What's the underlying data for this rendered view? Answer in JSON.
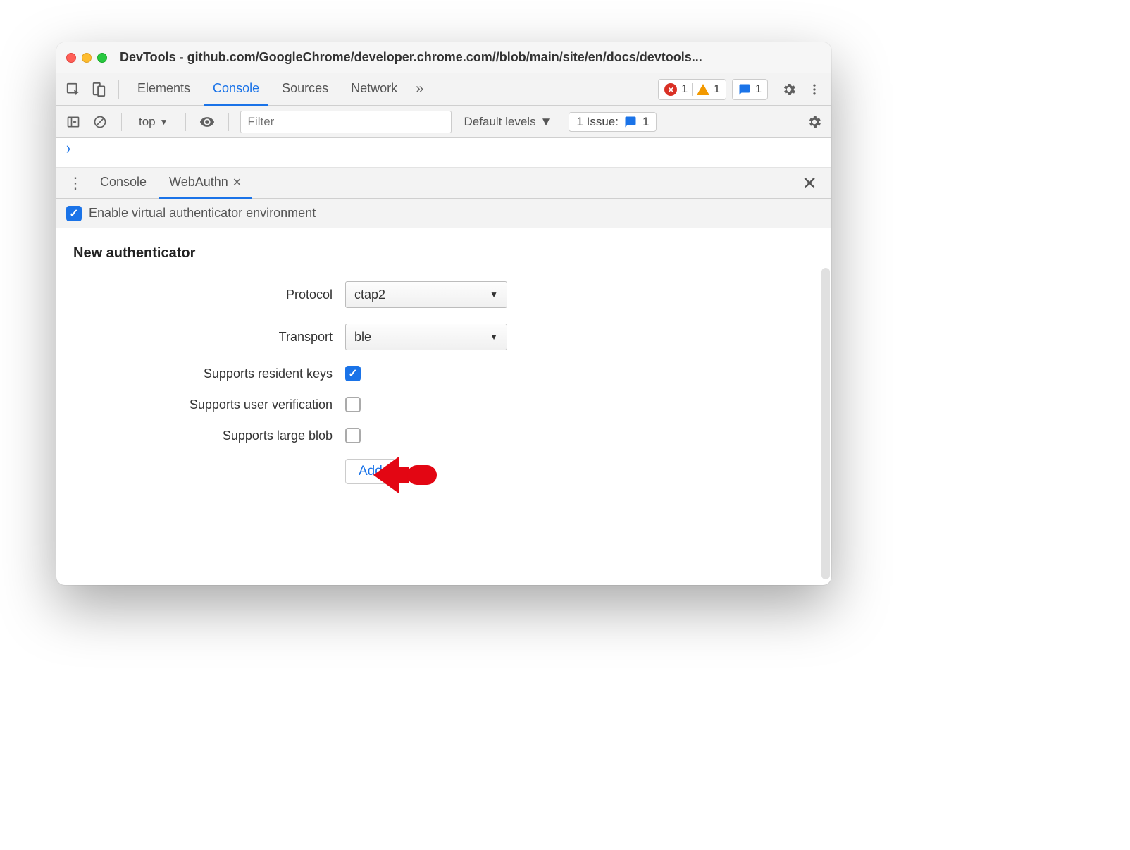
{
  "window": {
    "title": "DevTools - github.com/GoogleChrome/developer.chrome.com//blob/main/site/en/docs/devtools..."
  },
  "main_tabs": {
    "items": [
      "Elements",
      "Console",
      "Sources",
      "Network"
    ],
    "active": "Console",
    "error_count": "1",
    "warning_count": "1",
    "issue_count": "1"
  },
  "console_toolbar": {
    "context": "top",
    "filter_placeholder": "Filter",
    "levels_label": "Default levels",
    "issues_label": "1 Issue:",
    "issues_count": "1"
  },
  "drawer": {
    "tabs": [
      "Console",
      "WebAuthn"
    ],
    "active": "WebAuthn"
  },
  "webauthn": {
    "enable_label": "Enable virtual authenticator environment",
    "enable_checked": true,
    "section_title": "New authenticator",
    "fields": {
      "protocol": {
        "label": "Protocol",
        "value": "ctap2"
      },
      "transport": {
        "label": "Transport",
        "value": "ble"
      },
      "resident_keys": {
        "label": "Supports resident keys",
        "checked": true
      },
      "user_verification": {
        "label": "Supports user verification",
        "checked": false
      },
      "large_blob": {
        "label": "Supports large blob",
        "checked": false
      }
    },
    "add_button": "Add"
  }
}
